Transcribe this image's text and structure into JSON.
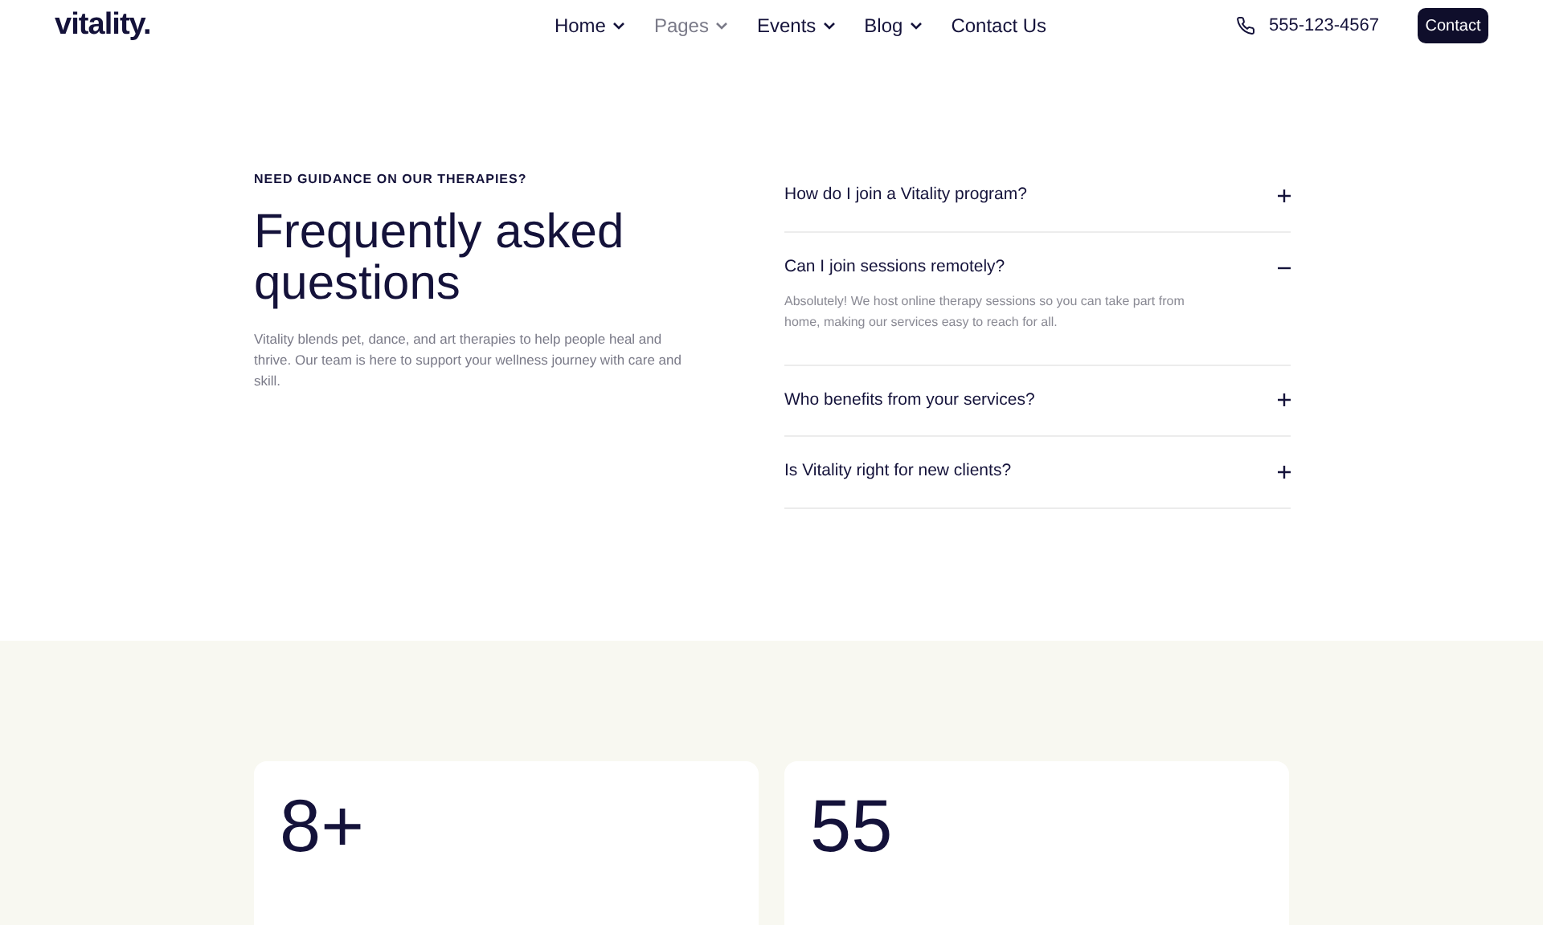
{
  "header": {
    "logo": "vitality.",
    "nav": [
      {
        "label": "Home",
        "selected": false,
        "menu": true
      },
      {
        "label": "Pages",
        "selected": true,
        "menu": true
      },
      {
        "label": "Events",
        "selected": false,
        "menu": true
      },
      {
        "label": "Blog",
        "selected": false,
        "menu": true
      },
      {
        "label": "Contact Us",
        "selected": false,
        "menu": false
      }
    ],
    "phone": "555-123-4567",
    "button": "Contact"
  },
  "faq": {
    "eyebrow": "NEED GUIDANCE ON OUR THERAPIES?",
    "title": "Frequently asked questions",
    "intro": "Vitality blends pet, dance, and art therapies to help people heal and thrive. Our team is here to support your wellness journey with care and skill.",
    "items": [
      {
        "question": "How do I join a Vitality program?",
        "expanded": false
      },
      {
        "question": "Can I join sessions remotely?",
        "expanded": true,
        "answer": "Absolutely! We host online therapy sessions so you can take part from home, making our services easy to reach for all."
      },
      {
        "question": "Who benefits from your services?",
        "expanded": false
      },
      {
        "question": "Is Vitality right for new clients?",
        "expanded": false
      }
    ]
  },
  "stats": [
    {
      "value": "8+"
    },
    {
      "value": "55"
    }
  ]
}
